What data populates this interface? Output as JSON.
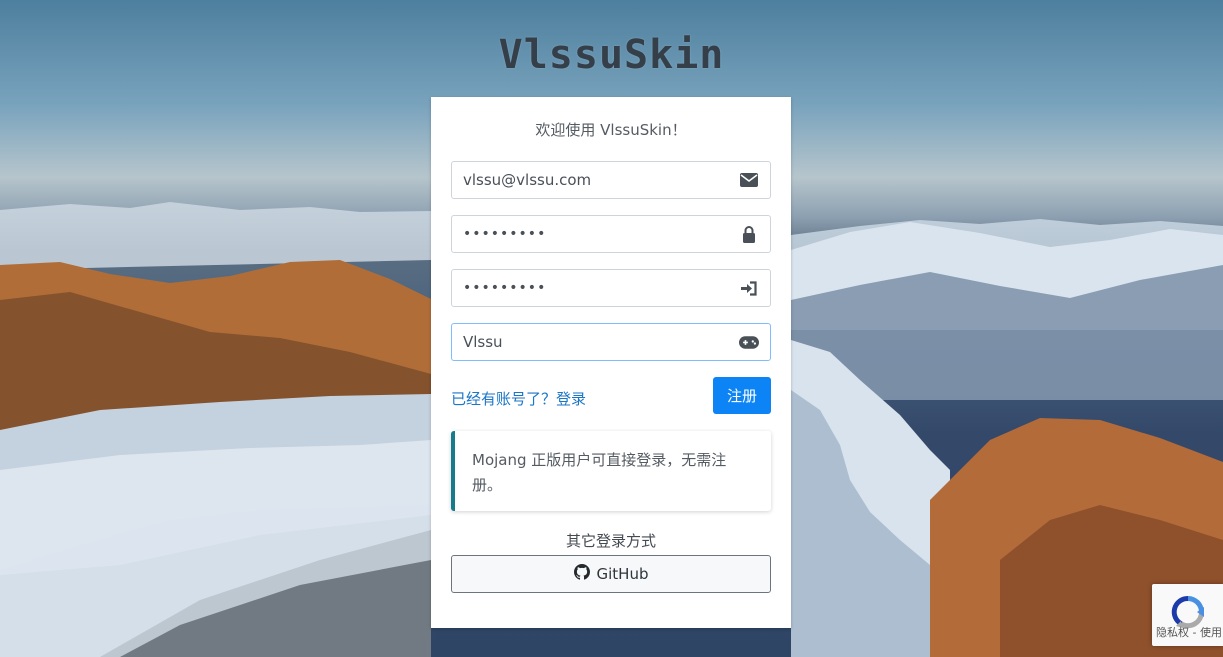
{
  "site": {
    "title": "VlssuSkin"
  },
  "form": {
    "welcome": "欢迎使用 VlssuSkin！",
    "email_value": "vlssu@vlssu.com",
    "password_value": "•••••••••",
    "confirm_value": "•••••••••",
    "nickname_value": "Vlssu",
    "login_link": "已经有账号了？登录",
    "register_button": "注册",
    "callout_text": "Mojang 正版用户可直接登录，无需注册。",
    "other_login": "其它登录方式",
    "github_button": "GitHub"
  },
  "recaptcha": {
    "text": "隐私权 - 使用条款"
  },
  "icons": {
    "email": "envelope-icon",
    "password": "lock-icon",
    "confirm": "sign-in-icon",
    "nickname": "gamepad-icon",
    "github": "github-icon",
    "recaptcha": "recaptcha-icon"
  },
  "colors": {
    "primary": "#0d84f5",
    "link": "#1a76c6",
    "callout_border": "#177b8c",
    "input_focus_border": "#80bdff"
  }
}
